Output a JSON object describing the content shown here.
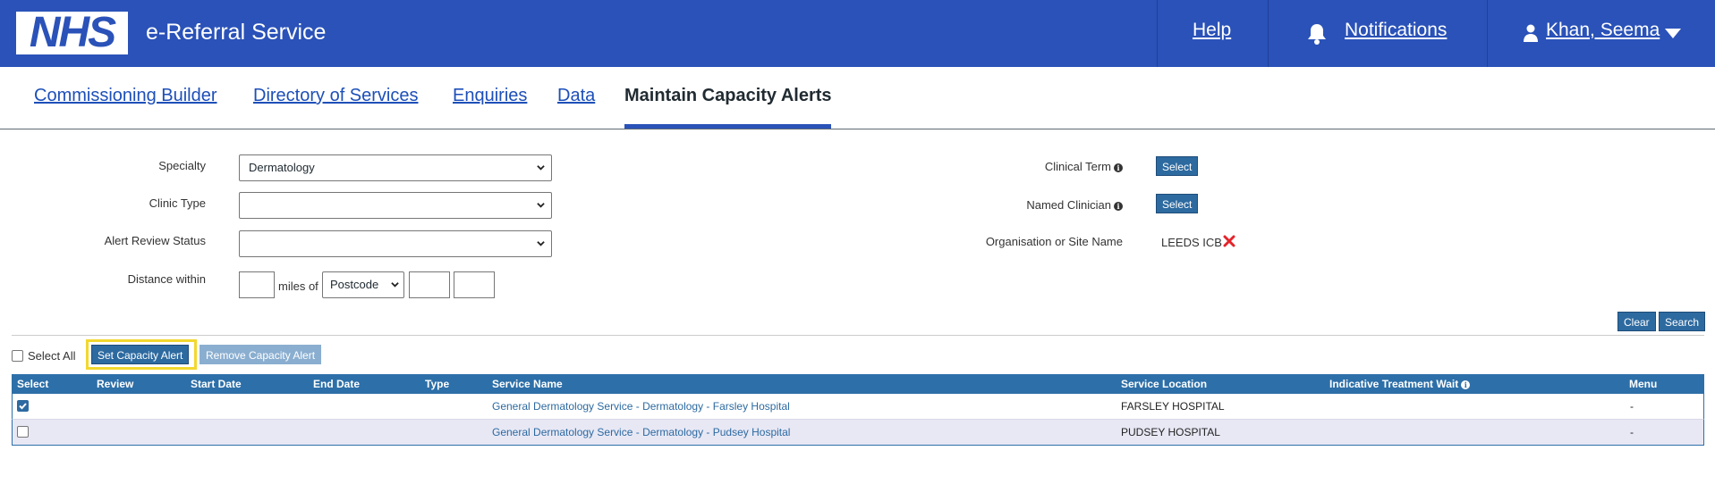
{
  "header": {
    "logo_text": "NHS",
    "app_name": "e-Referral Service",
    "help": "Help",
    "notifications": "Notifications",
    "user": "Khan, Seema"
  },
  "nav": {
    "tabs": [
      "Commissioning Builder",
      "Directory of Services",
      "Enquiries",
      "Data",
      "Maintain Capacity Alerts"
    ],
    "active": "Maintain Capacity Alerts"
  },
  "filters": {
    "specialty_label": "Specialty",
    "specialty_value": "Dermatology",
    "clinic_type_label": "Clinic Type",
    "clinic_type_value": "",
    "alert_review_label": "Alert Review Status",
    "alert_review_value": "",
    "distance_label": "Distance within",
    "miles_of": "miles of",
    "postcode_option": "Postcode",
    "clinical_term_label": "Clinical Term",
    "named_clinician_label": "Named Clinician",
    "org_label": "Organisation or Site Name",
    "org_value": "LEEDS ICB",
    "select_label": "Select"
  },
  "actions": {
    "clear": "Clear",
    "search": "Search",
    "select_all": "Select All",
    "set_alert": "Set Capacity Alert",
    "remove_alert": "Remove Capacity Alert"
  },
  "table": {
    "columns": [
      "Select",
      "Review",
      "Start Date",
      "End Date",
      "Type",
      "Service Name",
      "Service Location",
      "Indicative Treatment Wait",
      "Menu"
    ],
    "rows": [
      {
        "checked": true,
        "review": "",
        "start": "",
        "end": "",
        "type": "",
        "service": "General Dermatology Service - Dermatology - Farsley Hospital",
        "location": "FARSLEY HOSPITAL",
        "wait": "",
        "menu": "-"
      },
      {
        "checked": false,
        "review": "",
        "start": "",
        "end": "",
        "type": "",
        "service": "General Dermatology Service - Dermatology - Pudsey Hospital",
        "location": "PUDSEY HOSPITAL",
        "wait": "",
        "menu": "-"
      }
    ]
  },
  "colors": {
    "header_bg": "#2a52b8",
    "table_header": "#2d6fa8",
    "highlight": "#f2d82e",
    "row_alt": "#e8e8f5"
  }
}
